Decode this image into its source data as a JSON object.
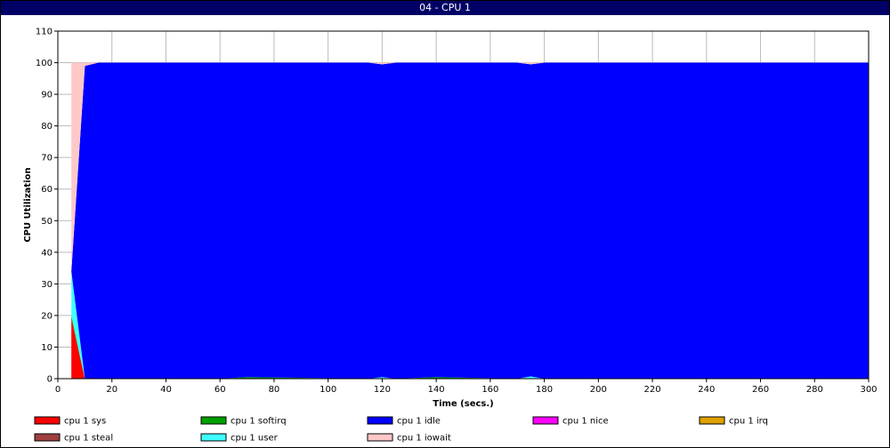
{
  "window": {
    "title": "04 - CPU 1"
  },
  "colors": {
    "background": "#ffffff",
    "grid": "#bbbbbb",
    "titlebar": "#000066"
  },
  "chart_data": {
    "type": "area",
    "stacked": true,
    "xlabel": "Time (secs.)",
    "ylabel": "CPU Utilization",
    "xlim": [
      0,
      300
    ],
    "ylim": [
      0,
      110
    ],
    "xticks": [
      0,
      20,
      40,
      60,
      80,
      100,
      120,
      140,
      160,
      180,
      200,
      220,
      240,
      260,
      280,
      300
    ],
    "yticks": [
      0,
      10,
      20,
      30,
      40,
      50,
      60,
      70,
      80,
      90,
      100,
      110
    ],
    "grid": true,
    "legend_position": "bottom",
    "x": [
      5,
      10,
      15,
      60,
      70,
      115,
      120,
      125,
      140,
      170,
      175,
      180,
      300
    ],
    "series": [
      {
        "name": "cpu 1 sys",
        "color": "#ff0000",
        "values": [
          19,
          0,
          0,
          0,
          0,
          0,
          0,
          0,
          0,
          0,
          0,
          0,
          0
        ]
      },
      {
        "name": "cpu 1 softirq",
        "color": "#00a000",
        "values": [
          1,
          0,
          0,
          0,
          0.5,
          0,
          0,
          0,
          0.5,
          0,
          0,
          0,
          0
        ]
      },
      {
        "name": "cpu 1 nice",
        "color": "#ff00ff",
        "values": [
          0,
          0,
          0,
          0,
          0,
          0,
          0,
          0,
          0,
          0,
          0,
          0,
          0
        ]
      },
      {
        "name": "cpu 1 irq",
        "color": "#e0a000",
        "values": [
          0,
          0,
          0,
          0,
          0,
          0,
          0,
          0,
          0,
          0,
          0,
          0,
          0
        ]
      },
      {
        "name": "cpu 1 steal",
        "color": "#a04040",
        "values": [
          0,
          0,
          0,
          0,
          0,
          0,
          0,
          0,
          0,
          0,
          0,
          0,
          0
        ]
      },
      {
        "name": "cpu 1 user",
        "color": "#40ffff",
        "values": [
          14,
          0,
          0,
          0,
          0,
          0,
          0.5,
          0,
          0,
          0,
          0.7,
          0,
          0
        ]
      },
      {
        "name": "cpu 1 idle",
        "color": "#0000ff",
        "values": [
          0,
          99,
          100,
          100,
          99.5,
          100,
          99,
          100,
          99.5,
          100,
          98.8,
          100,
          100
        ]
      },
      {
        "name": "cpu 1 iowait",
        "color": "#ffc8c8",
        "values": [
          66,
          1,
          0,
          0,
          0,
          0,
          0.5,
          0,
          0,
          0,
          0.5,
          0,
          0
        ]
      }
    ],
    "legend_order": [
      "cpu 1 sys",
      "cpu 1 softirq",
      "cpu 1 idle",
      "cpu 1 nice",
      "cpu 1 irq",
      "cpu 1 steal",
      "cpu 1 user",
      "cpu 1 iowait"
    ]
  }
}
